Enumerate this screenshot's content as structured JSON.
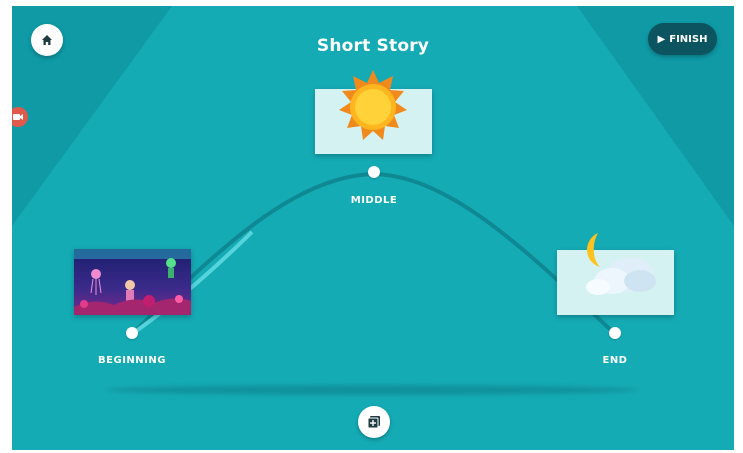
{
  "app": {
    "title": "Short Story"
  },
  "toolbar": {
    "finish_label": "FINISH",
    "home_icon": "home-icon",
    "record_icon": "camera-icon"
  },
  "story": {
    "points": [
      {
        "label": "BEGINNING",
        "card": "underwater-scene"
      },
      {
        "label": "MIDDLE",
        "card": "sun-sticker"
      },
      {
        "label": "END",
        "card": "moon-cloud-sticker"
      }
    ],
    "add_icon": "add-scene-icon"
  },
  "colors": {
    "background": "#11a3ae",
    "finish": "#0c5560",
    "card": "#d5f2f2",
    "record": "#e05a4c"
  }
}
